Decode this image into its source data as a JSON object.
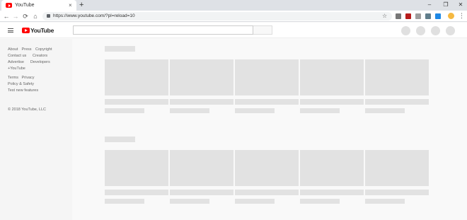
{
  "browser": {
    "tab_title": "YouTube",
    "tab_close": "×",
    "new_tab": "+",
    "window_controls": {
      "minimize": "–",
      "maximize": "❐",
      "close": "✕"
    },
    "nav": {
      "back": "←",
      "forward": "→",
      "reload": "⟳",
      "home": "⌂"
    },
    "url": "https://www.youtube.com/?pl=reload=10",
    "star": "☆",
    "menu": "⋮",
    "extension_colors": [
      "#777777",
      "#b71c1c",
      "#9e9e9e",
      "#607d8b",
      "#1e88e5"
    ]
  },
  "youtube": {
    "logo_text": "YouTube",
    "brand_color": "#ff0000",
    "search": {
      "placeholder": ""
    }
  },
  "guide": {
    "footer_links": [
      [
        "About",
        "Press",
        "Copyright"
      ],
      [
        "Contact us",
        "Creators"
      ],
      [
        "Advertise",
        "Developers"
      ],
      [
        "+YouTube"
      ]
    ],
    "policy_links": [
      [
        "Terms",
        "Privacy"
      ],
      [
        "Policy & Safety"
      ],
      [
        "Test new features"
      ]
    ],
    "copyright": "© 2018 YouTube, LLC"
  },
  "content": {
    "placeholder_color": "#e2e2e2",
    "shelves": 2,
    "cards_per_shelf": 5
  }
}
